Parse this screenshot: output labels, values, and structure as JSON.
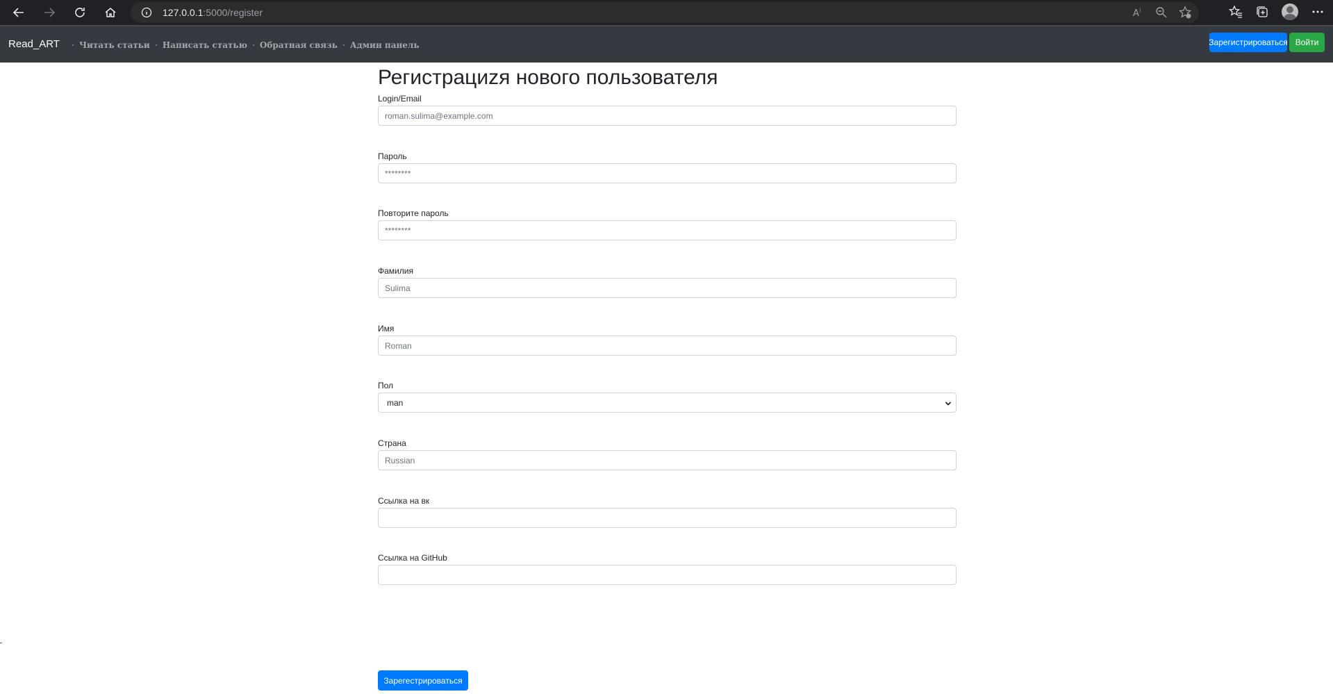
{
  "browser": {
    "url_host": "127.0.0.1",
    "url_path": ":5000/register"
  },
  "navbar": {
    "brand": "Read_ART",
    "links": [
      "Читать статьи",
      "Написать статью",
      "Обратная связь",
      "Админ панель"
    ],
    "register_button": "Зарегистрироваться",
    "login_button": "Войти"
  },
  "form": {
    "title": "Регистрациzя нового пользователя",
    "fields": [
      {
        "label": "Login/Email",
        "placeholder": "roman.sulima@example.com"
      },
      {
        "label": "Пароль",
        "placeholder": "********"
      },
      {
        "label": "Повторите пароль",
        "placeholder": "********"
      },
      {
        "label": "Фамилия",
        "placeholder": "Sulima"
      },
      {
        "label": "Имя",
        "placeholder": "Roman"
      },
      {
        "label": "Пол",
        "value": "man"
      },
      {
        "label": "Страна",
        "placeholder": "Russian"
      },
      {
        "label": "Ссылка на вк",
        "placeholder": ""
      },
      {
        "label": "Ссылка на GitHub",
        "placeholder": ""
      }
    ],
    "submit_button": "Зарегестрироваться"
  },
  "colors": {
    "navbar_bg": "#343a40",
    "primary": "#007bff",
    "success": "#28a745"
  }
}
